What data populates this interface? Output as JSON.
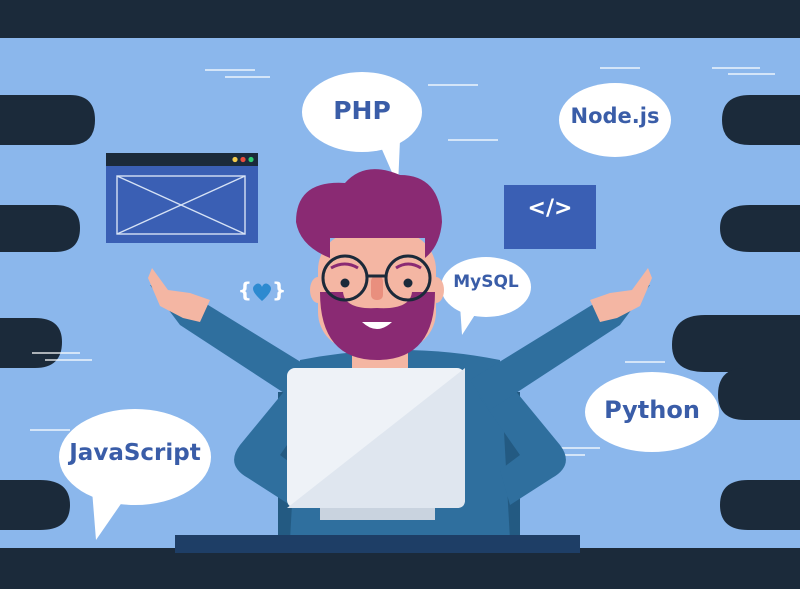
{
  "labels": {
    "php": "PHP",
    "nodejs": "Node.js",
    "mysql": "MySQL",
    "python": "Python",
    "javascript": "JavaScript",
    "code_tag": "</>",
    "heart_code_open": "{",
    "heart_code_close": "}"
  },
  "colors": {
    "background": "#8bb7ec",
    "dark_frame": "#1b2a3a",
    "bubble": "#ffffff",
    "bubble_text": "#3a5da8",
    "window_panel": "#3a5fb4",
    "code_panel": "#3a5fb4",
    "shirt": "#2f6f9e",
    "shirt_dark": "#235a82",
    "hair": "#8a2a73",
    "skin": "#f4b6a3",
    "laptop": "#eef2f7",
    "accent_heart": "#2d8ad0"
  },
  "icons": [
    "window-icon",
    "code-tag-icon",
    "heart-code-icon",
    "laptop-icon"
  ]
}
